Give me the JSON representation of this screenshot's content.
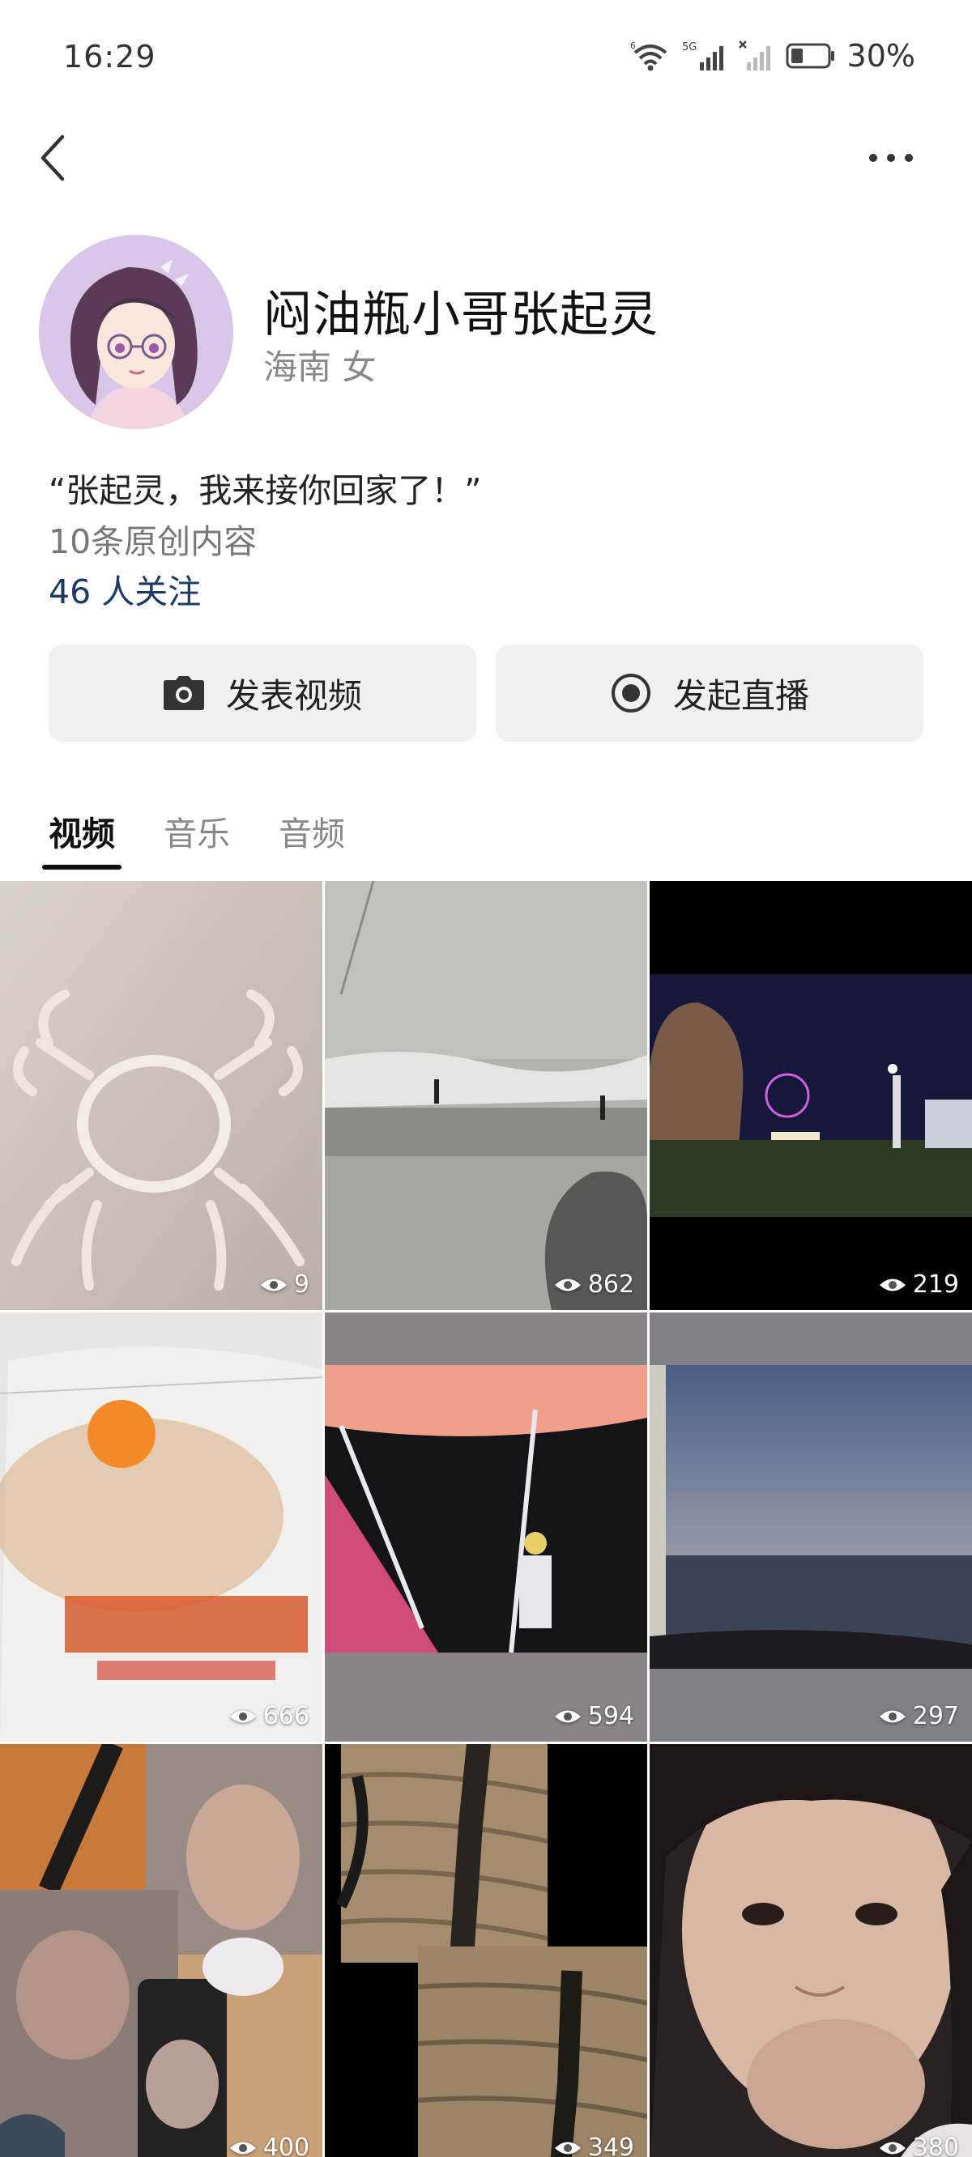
{
  "status_bar": {
    "time": "16:29",
    "battery": "30%",
    "icons": [
      "wifi-icon",
      "signal-5g-icon",
      "signal-disabled-icon",
      "battery-icon"
    ],
    "wifi_label": "6",
    "net_label": "5G"
  },
  "nav": {
    "back_icon": "back-chevron-icon",
    "more_icon": "more-dots-icon"
  },
  "profile": {
    "name": "闷油瓶小哥张起灵",
    "meta": "海南 女",
    "bio": "“张起灵，我来接你回家了！”",
    "content_count": "10条原创内容",
    "followers": "46 人关注"
  },
  "actions": {
    "publish_video": "发表视频",
    "start_live": "发起直播"
  },
  "tabs": [
    {
      "label": "视频",
      "active": true
    },
    {
      "label": "音乐",
      "active": false
    },
    {
      "label": "音频",
      "active": false
    }
  ],
  "videos": [
    {
      "views": "9"
    },
    {
      "views": "862"
    },
    {
      "views": "219"
    },
    {
      "views": "666"
    },
    {
      "views": "594"
    },
    {
      "views": "297"
    },
    {
      "views": "400"
    },
    {
      "views": "349"
    },
    {
      "views": "380"
    }
  ],
  "colors": {
    "follow_link": "#1e3a64",
    "button_bg": "#f0f0f0"
  }
}
